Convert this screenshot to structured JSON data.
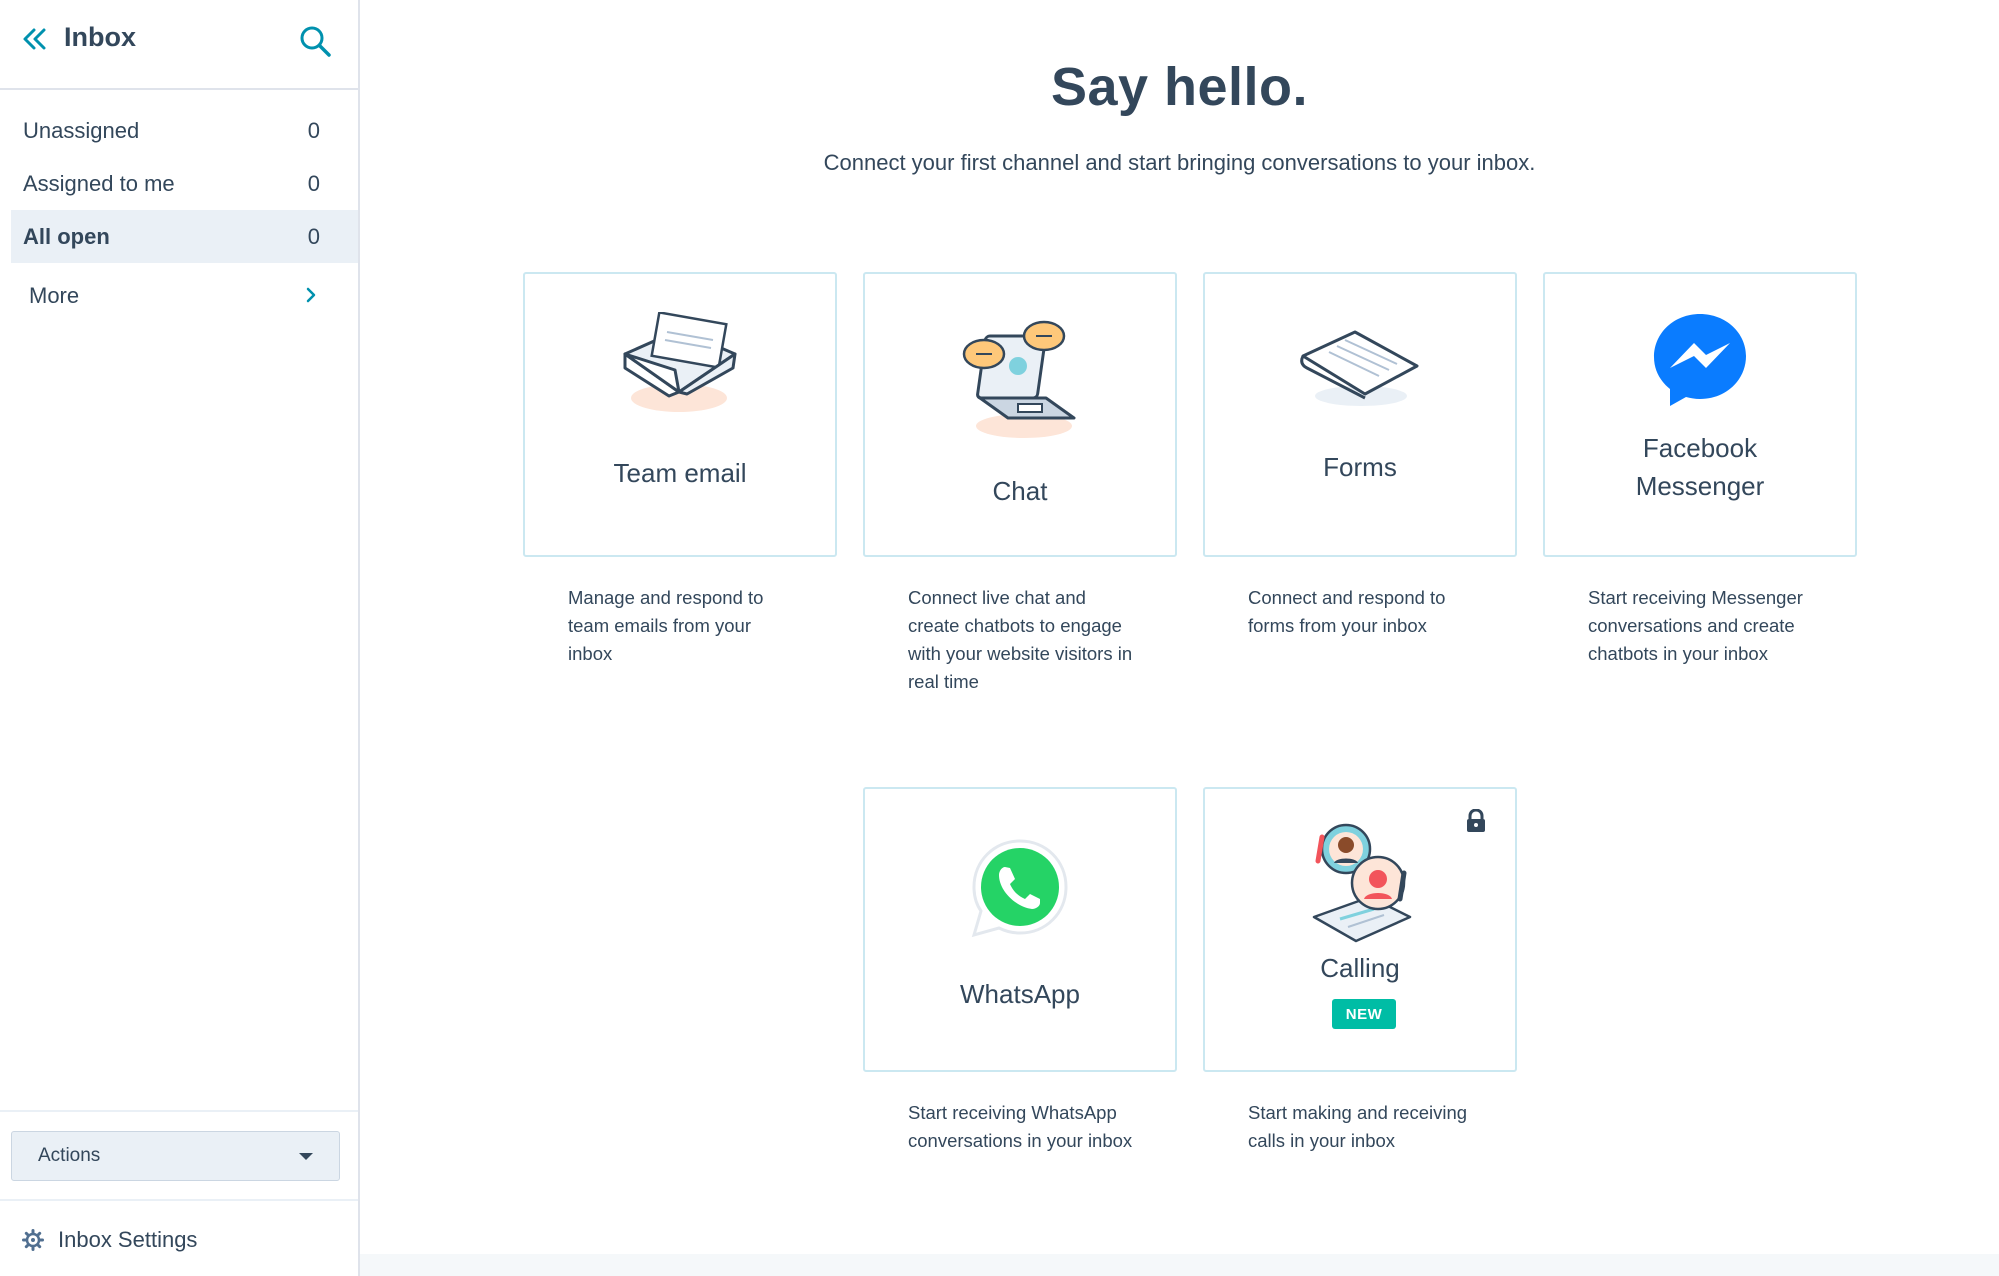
{
  "sidebar": {
    "title": "Inbox",
    "views": [
      {
        "label": "Unassigned",
        "count": "0"
      },
      {
        "label": "Assigned to me",
        "count": "0"
      },
      {
        "label": "All open",
        "count": "0"
      }
    ],
    "more_label": "More",
    "actions_label": "Actions",
    "settings_label": "Inbox Settings"
  },
  "main": {
    "heading": "Say hello.",
    "subtitle": "Connect your first channel and start bringing conversations to your inbox.",
    "channels": [
      {
        "label": "Team email",
        "description": "Manage and respond to team emails from your inbox",
        "icon": "envelope-icon"
      },
      {
        "label": "Chat",
        "description": "Connect live chat and create chatbots to engage with your website visitors in real time",
        "icon": "laptop-chat-icon"
      },
      {
        "label": "Forms",
        "description": "Connect and respond to forms from your inbox",
        "icon": "form-sheet-icon"
      },
      {
        "label": "Facebook Messenger",
        "description": "Start receiving Messenger conversations and create chatbots in your inbox",
        "icon": "messenger-icon"
      },
      {
        "label": "WhatsApp",
        "description": "Start receiving WhatsApp conversations in your inbox",
        "icon": "whatsapp-icon"
      },
      {
        "label": "Calling",
        "description": "Start making and receiving calls in your inbox",
        "icon": "calling-icon",
        "badge": "NEW",
        "locked": true
      }
    ]
  },
  "colors": {
    "text": "#33475b",
    "accent_teal": "#0091ae",
    "card_border": "#cbe8f1",
    "active_bg": "#eaf0f6",
    "badge_green": "#00bda5",
    "messenger_blue": "#0a7cff",
    "whatsapp_green": "#25d366"
  }
}
